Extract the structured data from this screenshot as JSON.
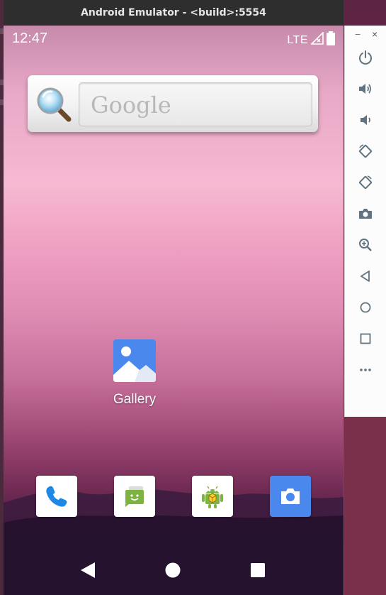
{
  "window": {
    "title": "Android Emulator - <build>:5554"
  },
  "status_bar": {
    "time": "12:47",
    "network": "LTE",
    "signal_icon": "signal-icon",
    "battery_icon": "battery-icon"
  },
  "google_widget": {
    "logo_text": "Google",
    "icon": "magnifier-icon"
  },
  "home": {
    "gallery": {
      "label": "Gallery",
      "icon": "gallery-icon"
    }
  },
  "dock": [
    {
      "name": "phone",
      "icon": "phone-icon"
    },
    {
      "name": "messages",
      "icon": "messages-icon"
    },
    {
      "name": "android-app",
      "icon": "android-icon"
    },
    {
      "name": "camera",
      "icon": "camera-icon"
    }
  ],
  "nav": {
    "back": "back-icon",
    "home": "home-icon",
    "recents": "recents-icon"
  },
  "controls": {
    "minimize": "−",
    "close": "×",
    "buttons": [
      "power-icon",
      "volume-up-icon",
      "volume-down-icon",
      "rotate-left-icon",
      "rotate-right-icon",
      "screenshot-icon",
      "zoom-icon",
      "back-icon",
      "home-icon",
      "overview-icon",
      "more-icon"
    ]
  },
  "colors": {
    "accent_blue": "#1e88e5",
    "gallery_blue": "#4a88ee",
    "android_green": "#7cb342"
  }
}
